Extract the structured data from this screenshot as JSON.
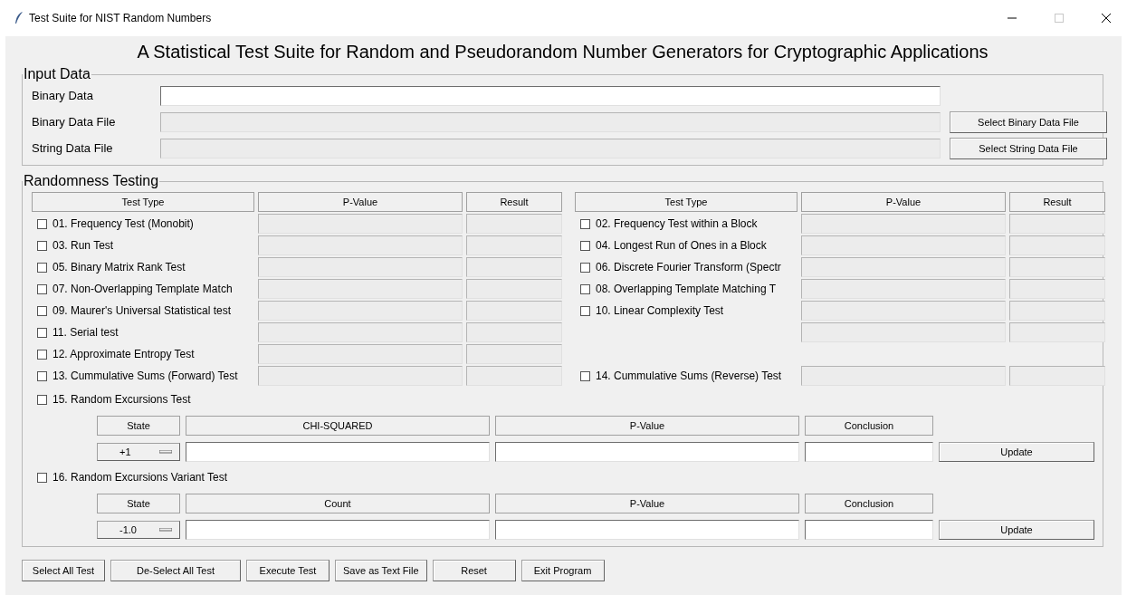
{
  "window": {
    "title": "Test Suite for NIST Random Numbers"
  },
  "heading": "A Statistical Test Suite for Random and Pseudorandom Number Generators for Cryptographic Applications",
  "input_data": {
    "title": "Input Data",
    "fields": [
      {
        "label": "Binary Data",
        "editable": true
      },
      {
        "label": "Binary Data File",
        "editable": false,
        "button": "Select Binary Data File"
      },
      {
        "label": "String Data File",
        "editable": false,
        "button": "Select String Data File"
      }
    ]
  },
  "randomness_testing": {
    "title": "Randomness Testing",
    "columns_left": [
      "Test Type",
      "P-Value",
      "Result"
    ],
    "columns_right": [
      "Test Type",
      "P-Value",
      "Result"
    ],
    "tests_left": [
      {
        "kind": "test",
        "label": "01. Frequency Test (Monobit)",
        "checked": false
      },
      {
        "kind": "test",
        "label": "03. Run Test",
        "checked": false
      },
      {
        "kind": "test",
        "label": "05. Binary Matrix Rank Test",
        "checked": false
      },
      {
        "kind": "test",
        "label": "07. Non-Overlapping Template Match",
        "checked": false
      },
      {
        "kind": "test",
        "label": "09. Maurer's Universal Statistical test",
        "checked": false
      },
      {
        "kind": "test",
        "label": "11. Serial test",
        "checked": false
      },
      {
        "kind": "test",
        "label": "12. Approximate Entropy Test",
        "checked": false
      },
      {
        "kind": "test",
        "label": "13. Cummulative Sums (Forward) Test",
        "checked": false
      }
    ],
    "tests_right": [
      {
        "kind": "test",
        "label": "02. Frequency Test within a Block",
        "checked": false
      },
      {
        "kind": "test",
        "label": "04. Longest Run of Ones in a Block",
        "checked": false
      },
      {
        "kind": "test",
        "label": "06. Discrete Fourier Transform (Spectr",
        "checked": false
      },
      {
        "kind": "test",
        "label": "08. Overlapping Template Matching T",
        "checked": false
      },
      {
        "kind": "test",
        "label": "10. Linear Complexity Test",
        "checked": false
      },
      {
        "kind": "fields_only"
      },
      {
        "kind": "gap"
      },
      {
        "kind": "test",
        "label": "14. Cummulative Sums (Reverse) Test",
        "checked": false
      }
    ],
    "excursions": [
      {
        "label": "15. Random Excursions Test",
        "checked": false,
        "columns": [
          "State",
          "CHI-SQUARED",
          "P-Value",
          "Conclusion"
        ],
        "state": "+1",
        "button": "Update"
      },
      {
        "label": "16. Random Excursions Variant Test",
        "checked": false,
        "columns": [
          "State",
          "Count",
          "P-Value",
          "Conclusion"
        ],
        "state": "-1.0",
        "button": "Update"
      }
    ]
  },
  "buttons": [
    "Select All Test",
    "De-Select All Test",
    "Execute Test",
    "Save as Text File",
    "Reset",
    "Exit Program"
  ]
}
